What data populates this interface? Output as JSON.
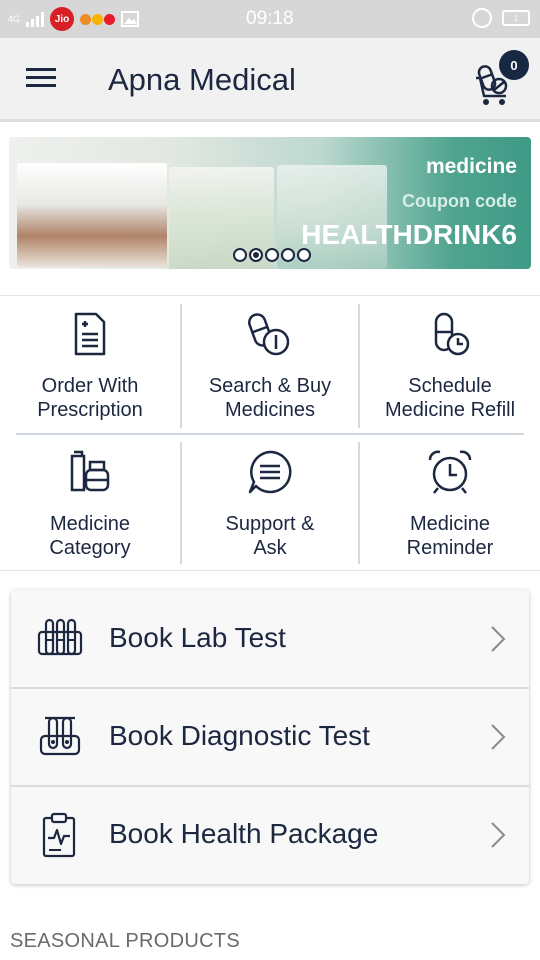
{
  "status_bar": {
    "network": "4G",
    "carrier": "Jio",
    "time": "09:18",
    "battery": "1"
  },
  "header": {
    "title": "Apna Medical",
    "cart_count": "0"
  },
  "banner": {
    "line1": "medicine",
    "line2": "Coupon code",
    "code": "HEALTHDRINK6",
    "slides": 5,
    "active_slide": 2
  },
  "grid": {
    "items": [
      {
        "label": "Order With Prescription",
        "icon": "prescription-icon"
      },
      {
        "label": "Search & Buy Medicines",
        "icon": "search-medicine-icon"
      },
      {
        "label": "Schedule Medicine Refill",
        "icon": "refill-icon"
      },
      {
        "label": "Medicine Category",
        "icon": "category-icon"
      },
      {
        "label": "Support & Ask",
        "icon": "chat-icon"
      },
      {
        "label": "Medicine Reminder",
        "icon": "alarm-clock-icon"
      }
    ]
  },
  "services": {
    "rows": [
      {
        "label": "Book Lab Test",
        "icon": "test-tubes-icon"
      },
      {
        "label": "Book Diagnostic Test",
        "icon": "diagnostic-icon"
      },
      {
        "label": "Book Health Package",
        "icon": "clipboard-icon"
      }
    ]
  },
  "sections": {
    "seasonal_title": "SEASONAL PRODUCTS"
  },
  "colors": {
    "primary": "#1c2740",
    "app_bar": "#f1f1f1",
    "banner_accent": "#3f9a86"
  }
}
